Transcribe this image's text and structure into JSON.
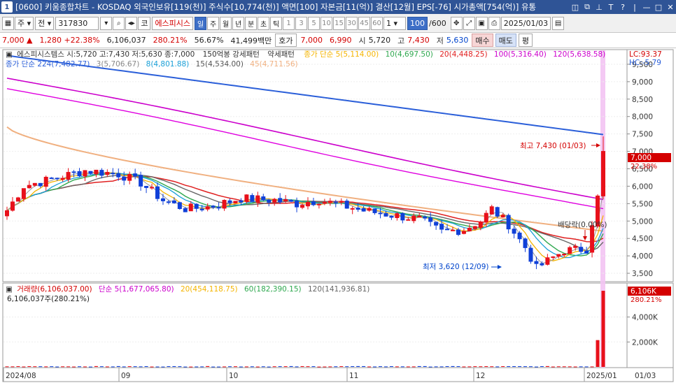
{
  "window": {
    "number": "1",
    "title": "[0600] 키움종합차트 - KOSDAQ 외국인보유[119(천)] 주식수[10,774(천)] 액면[100] 자본금[11(억)] 결산[12월] EPS[-76] 시가총액[754(억)] 유통"
  },
  "toolbar": {
    "stock_type": "주",
    "exchange": "전",
    "code": "317830",
    "name_prefix": "코",
    "stock_name": "에스피시스",
    "periods": [
      "일",
      "주",
      "월",
      "년",
      "분",
      "초",
      "틱"
    ],
    "active_period": "일",
    "intervals": [
      "1",
      "3",
      "5",
      "10",
      "15",
      "30",
      "45",
      "60"
    ],
    "interval_value": "1",
    "count_value": "100",
    "count_max": "/600",
    "date": "2025/01/03"
  },
  "quote": {
    "price": "7,000",
    "change_arrow": "▲",
    "change": "1,280",
    "change_pct": "+22.38%",
    "volume": "6,106,037",
    "volume_ratio": "280.21%",
    "turnover": "56.67%",
    "amount": "41,499백만",
    "bid_label": "호가",
    "bid1": "7,000",
    "bid2": "6,990",
    "open_label": "시",
    "open": "5,720",
    "high_label": "고",
    "high": "7,430",
    "low_label": "저",
    "low": "5,630",
    "buy_button": "매수",
    "sell_button": "매도",
    "eval_button": "평"
  },
  "legend": {
    "price_line": "에스피시스템스 시:5,720 고:7,430 저:5,630 종:7,000",
    "pattern1": "150억봉 강세패턴",
    "pattern2": "약세패턴",
    "ma_series": [
      {
        "label": "종가 단순 5(5,114.00)",
        "color": "#f4b400"
      },
      {
        "label": "10(4,697.50)",
        "color": "#2fa84f"
      },
      {
        "label": "20(4,448.25)",
        "color": "#e02020"
      },
      {
        "label": "100(5,316.40)",
        "color": "#cc00cc"
      },
      {
        "label": "120(5,638.58)",
        "color": "#cc00cc"
      }
    ],
    "ma_series2": [
      {
        "label": "종가 단순 224(7,482.77)",
        "color": "#2b5fd9"
      },
      {
        "label": "3(5,706.67)",
        "color": "#888888"
      },
      {
        "label": "8(4,801.88)",
        "color": "#1aa0d8"
      },
      {
        "label": "15(4,534.00)",
        "color": "#555555"
      },
      {
        "label": "45(4,711.56)",
        "color": "#f0b080"
      }
    ],
    "lc": "LC:93.37",
    "hc": "HC:-5.79"
  },
  "price_axis": [
    "9,500",
    "9,000",
    "8,500",
    "8,000",
    "7,500",
    "7,000",
    "6,500",
    "6,000",
    "5,500",
    "5,000",
    "4,500",
    "4,000",
    "3,500"
  ],
  "price_tag": {
    "value": "7,000",
    "pct": "22.38%"
  },
  "annotations": {
    "high": "최고 7,430 (01/03)",
    "low": "최저 3,620 (12/09)",
    "dividend": "배당락(0.00%)"
  },
  "volume_legend": {
    "items": [
      {
        "label": "거래량(6,106,037.00)",
        "color": "#d40000"
      },
      {
        "label": "단순 5(1,677,065.80)",
        "color": "#cc00cc"
      },
      {
        "label": "20(454,118.75)",
        "color": "#f4b400"
      },
      {
        "label": "60(182,390.15)",
        "color": "#2fa84f"
      },
      {
        "label": "120(141,936.81)",
        "color": "#666666"
      }
    ],
    "current": "6,106,037주(280.21%)"
  },
  "volume_axis": [
    "4,000K",
    "2,000K"
  ],
  "volume_tag": {
    "value": "6,106K",
    "pct": "280.21%"
  },
  "date_axis": [
    "2024/08",
    "09",
    "10",
    "11",
    "12",
    "2025/01",
    "01/03"
  ],
  "chart_data": {
    "type": "candlestick",
    "y_range": [
      3300,
      9800
    ],
    "volume_range": [
      0,
      6500000
    ],
    "candles_note": "daily OHLC, Aug 2024 - 2025/01/03",
    "last": {
      "date": "2025/01/03",
      "open": 5720,
      "high": 7430,
      "low": 5630,
      "close": 7000,
      "volume": 6106037
    },
    "high_point": {
      "date": "01/03",
      "value": 7430
    },
    "low_point": {
      "date": "12/09",
      "value": 3620
    },
    "moving_averages": {
      "ma5": 5114.0,
      "ma10": 4697.5,
      "ma20": 4448.25,
      "ma100": 5316.4,
      "ma120": 5638.58,
      "ma224": 7482.77
    }
  }
}
